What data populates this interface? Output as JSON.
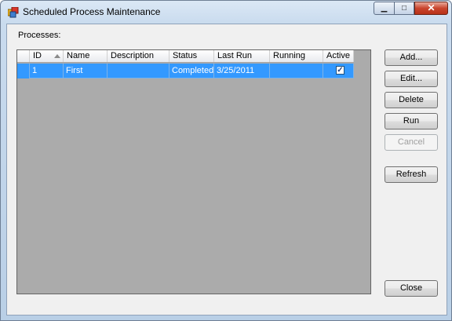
{
  "window": {
    "title": "Scheduled Process Maintenance",
    "minimize": "▁",
    "maximize": "□",
    "close": "✕"
  },
  "labels": {
    "processes": "Processes:"
  },
  "grid": {
    "columns": [
      "ID",
      "Name",
      "Description",
      "Status",
      "Last Run",
      "Running",
      "Active"
    ],
    "sorted_column": "ID",
    "rows": [
      {
        "id": "1",
        "name": "First",
        "description": "",
        "status": "Completed",
        "last_run": "3/25/2011",
        "running": "",
        "active": true,
        "selected": true
      }
    ]
  },
  "buttons": {
    "add": "Add...",
    "edit": "Edit...",
    "delete": "Delete",
    "run": "Run",
    "cancel": "Cancel",
    "refresh": "Refresh",
    "close": "Close"
  },
  "colors": {
    "selection": "#3399ff",
    "grid_background": "#ababab",
    "client_background": "#f0f0f0"
  }
}
